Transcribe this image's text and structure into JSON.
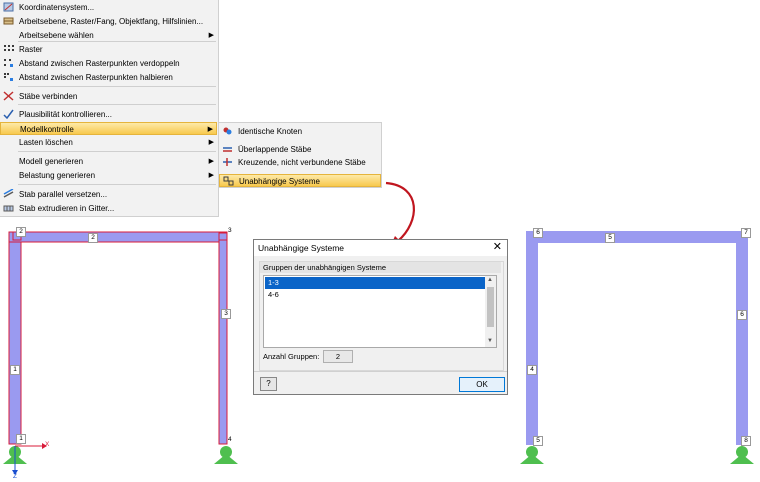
{
  "menu": {
    "items": [
      {
        "label": "Koordinatensystem...",
        "icon": "coordinate-system-icon",
        "arrow": false
      },
      {
        "label": "Arbeitsebene, Raster/Fang, Objektfang, Hilfslinien...",
        "icon": "workplane-grid-icon",
        "arrow": false
      },
      {
        "label": "Arbeitsebene wählen",
        "icon": "",
        "arrow": true
      },
      {
        "label": "Raster",
        "icon": "grid-icon",
        "arrow": false
      },
      {
        "label": "Abstand zwischen Rasterpunkten verdoppeln",
        "icon": "grid-double-icon",
        "arrow": false
      },
      {
        "label": "Abstand zwischen Rasterpunkten halbieren",
        "icon": "grid-half-icon",
        "arrow": false
      },
      {
        "label": "Stäbe verbinden",
        "icon": "connect-members-icon",
        "arrow": false
      },
      {
        "label": "Plausibilität kontrollieren...",
        "icon": "plausibility-check-icon",
        "arrow": false
      },
      {
        "label": "Modellkontrolle",
        "icon": "",
        "arrow": true
      },
      {
        "label": "Lasten löschen",
        "icon": "",
        "arrow": true
      },
      {
        "label": "Modell generieren",
        "icon": "",
        "arrow": true
      },
      {
        "label": "Belastung generieren",
        "icon": "",
        "arrow": true
      },
      {
        "label": "Stab parallel versetzen...",
        "icon": "offset-member-icon",
        "arrow": false
      },
      {
        "label": "Stab extrudieren in Gitter...",
        "icon": "extrude-member-icon",
        "arrow": false
      }
    ],
    "arrow_glyph": "▶"
  },
  "submenu": {
    "items": [
      {
        "label": "Identische Knoten",
        "icon": "identical-nodes-icon"
      },
      {
        "label": "Überlappende Stäbe",
        "icon": "overlapping-members-icon"
      },
      {
        "label": "Kreuzende, nicht verbundene Stäbe",
        "icon": "crossing-members-icon"
      },
      {
        "label": "Unabhängige Systeme",
        "icon": "independent-systems-icon"
      }
    ]
  },
  "dialog": {
    "title": "Unabhängige Systeme",
    "close": "✕",
    "group_header": "Gruppen der unabhängigen Systeme",
    "list": [
      "1-3",
      "4-6"
    ],
    "selected_index": 0,
    "count_label": "Anzahl Gruppen:",
    "count_value": "2",
    "help_glyph": "?",
    "ok_label": "OK",
    "scroll_up": "▲",
    "scroll_down": "▼"
  },
  "frame_left": {
    "nodes": [
      "1",
      "2",
      "3",
      "4"
    ],
    "members": [
      "1",
      "2",
      "3"
    ],
    "axis_x": "X",
    "axis_z": "Z"
  },
  "frame_right": {
    "nodes": [
      "5",
      "6",
      "7",
      "8"
    ],
    "members": [
      "4",
      "5",
      "6"
    ]
  },
  "colors": {
    "member": "#9a9af0",
    "member_selected_outline": "#d81b3a",
    "support": "#4fbf4f",
    "arrow": "#c0161f",
    "highlight": "#f8c94e",
    "selection": "#0a64c8"
  }
}
